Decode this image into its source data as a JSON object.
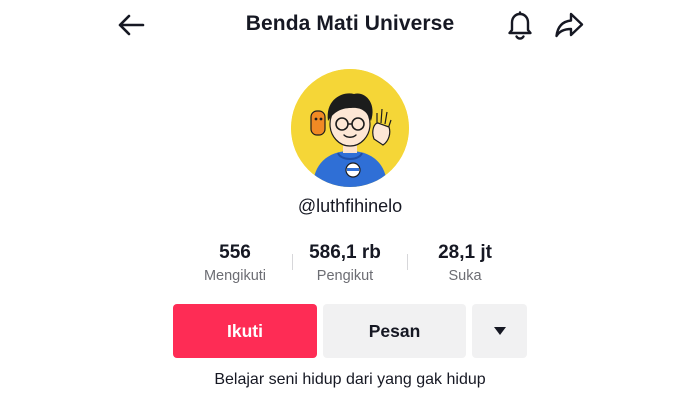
{
  "header": {
    "title": "Benda Mati Universe",
    "back_icon": "arrow-left-icon",
    "notify_icon": "bell-icon",
    "share_icon": "share-arrow-icon"
  },
  "profile": {
    "avatar_icon": "cartoon-avatar",
    "avatar_bg": "#f5d637",
    "username": "@luthfihinelo",
    "bio": "Belajar seni hidup dari yang gak hidup"
  },
  "stats": [
    {
      "value": "556",
      "label": "Mengikuti"
    },
    {
      "value": "586,1 rb",
      "label": "Pengikut"
    },
    {
      "value": "28,1 jt",
      "label": "Suka"
    }
  ],
  "actions": {
    "follow_label": "Ikuti",
    "message_label": "Pesan",
    "more_icon": "caret-down-icon"
  },
  "colors": {
    "accent": "#fe2c55",
    "secondary_button": "#f1f1f2",
    "muted_text": "#6c6d73",
    "text": "#161823"
  }
}
